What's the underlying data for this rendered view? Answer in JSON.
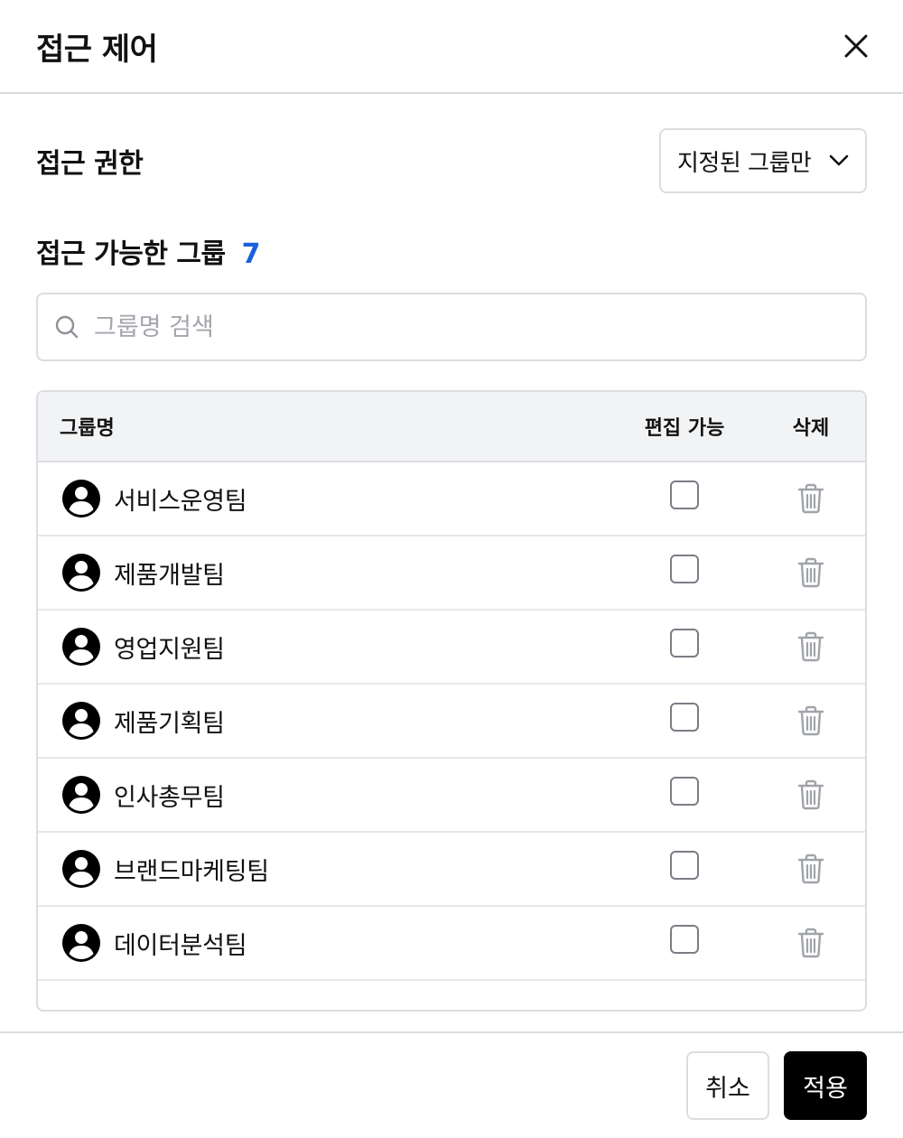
{
  "dialog": {
    "title": "접근 제어",
    "close_icon": "close-icon"
  },
  "permission": {
    "label": "접근 권한",
    "selected": "지정된 그룹만"
  },
  "groups": {
    "title": "접근 가능한 그룹",
    "count": "7",
    "count_color": "#1a5fe0",
    "search_placeholder": "그룹명 검색",
    "search_value": ""
  },
  "table": {
    "headers": {
      "name": "그룹명",
      "editable": "편집 가능",
      "delete": "삭제"
    },
    "rows": [
      {
        "name": "서비스운영팀",
        "editable": false
      },
      {
        "name": "제품개발팀",
        "editable": false
      },
      {
        "name": "영업지원팀",
        "editable": false
      },
      {
        "name": "제품기획팀",
        "editable": false
      },
      {
        "name": "인사총무팀",
        "editable": false
      },
      {
        "name": "브랜드마케팅팀",
        "editable": false
      },
      {
        "name": "데이터분석팀",
        "editable": false
      }
    ]
  },
  "footer": {
    "cancel_label": "취소",
    "apply_label": "적용"
  }
}
